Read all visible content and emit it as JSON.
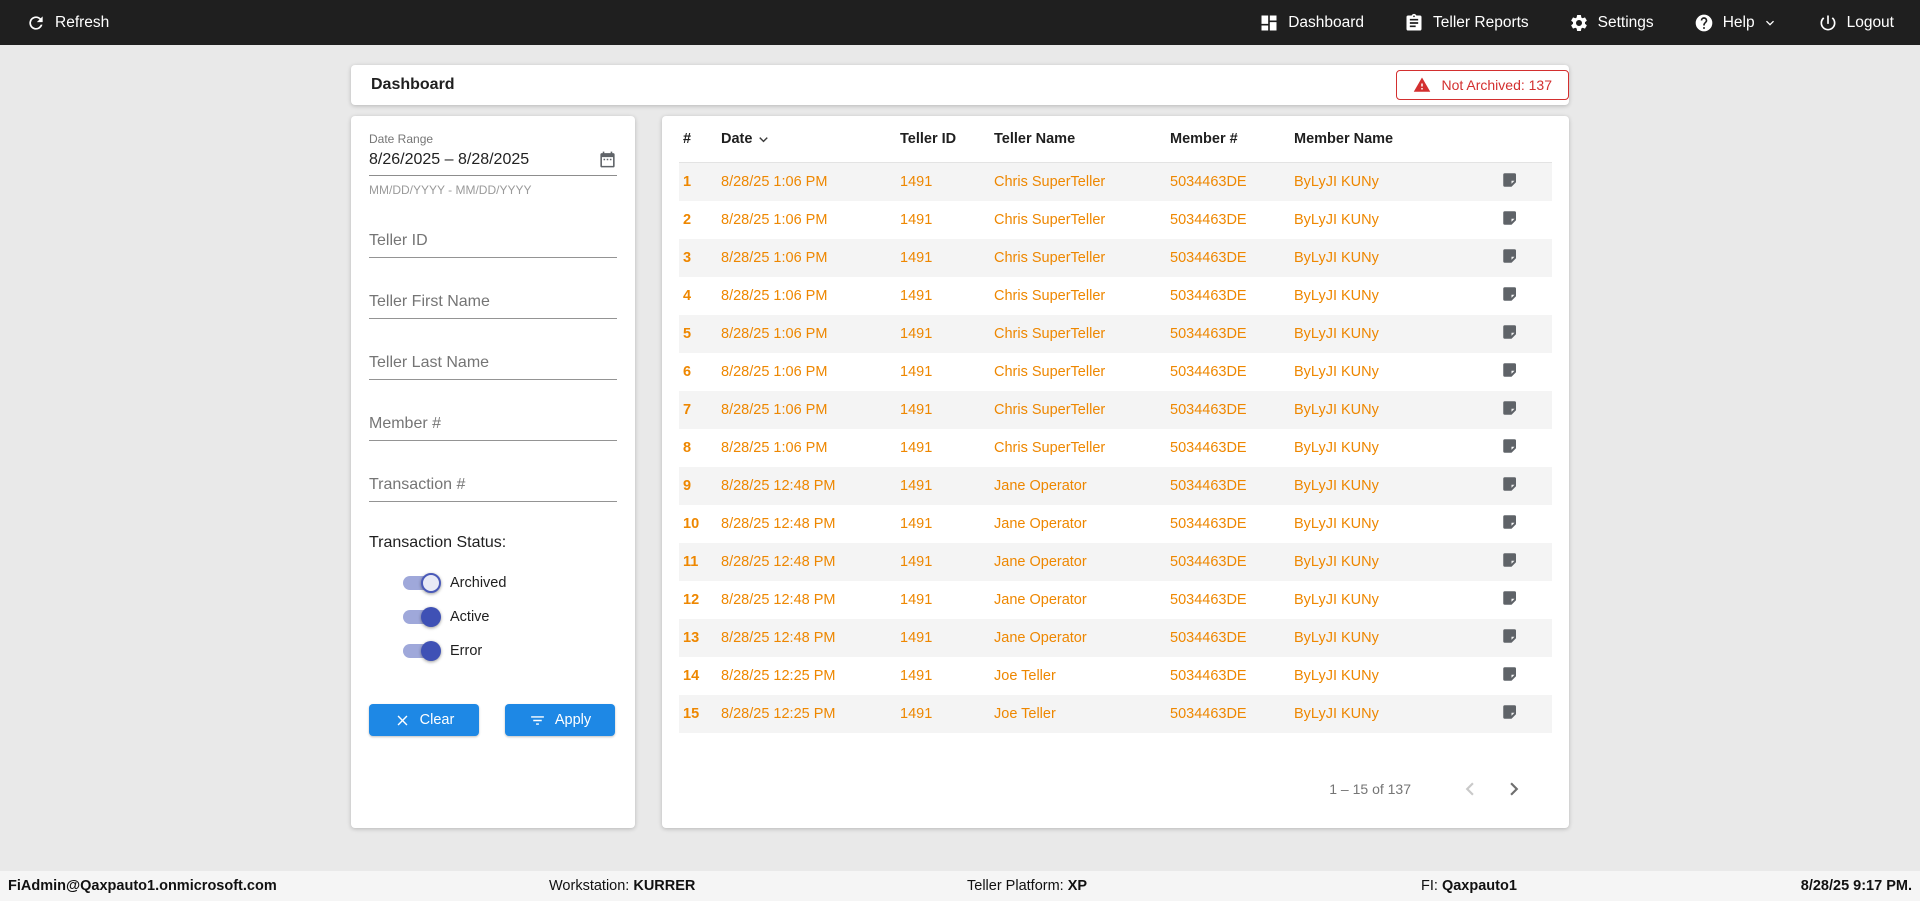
{
  "colors": {
    "topbar": "#1f1f1f",
    "accent_blue": "#1e88e5",
    "row_orange": "#ee8700",
    "alert_red": "#d32f2f",
    "toggle_thumb": "#3f51b5",
    "toggle_track": "#9fa8da"
  },
  "topnav": {
    "refresh": "Refresh",
    "dashboard": "Dashboard",
    "teller_reports": "Teller Reports",
    "settings": "Settings",
    "help": "Help",
    "logout": "Logout"
  },
  "header": {
    "title": "Dashboard",
    "alert_badge": "Not Archived: 137"
  },
  "filters": {
    "date_range_label": "Date Range",
    "date_range_value": "8/26/2025 – 8/28/2025",
    "date_range_hint": "MM/DD/YYYY - MM/DD/YYYY",
    "teller_id_placeholder": "Teller ID",
    "teller_first_name_placeholder": "Teller First Name",
    "teller_last_name_placeholder": "Teller Last Name",
    "member_placeholder": "Member #",
    "transaction_placeholder": "Transaction #",
    "status_label": "Transaction Status:",
    "toggles": [
      {
        "label": "Archived",
        "on": true,
        "hollow": true
      },
      {
        "label": "Active",
        "on": true
      },
      {
        "label": "Error",
        "on": true
      }
    ],
    "clear_label": "Clear",
    "apply_label": "Apply"
  },
  "table": {
    "columns": [
      "#",
      "Date",
      "Teller ID",
      "Teller Name",
      "Member #",
      "Member Name"
    ],
    "rows": [
      {
        "num": "1",
        "date": "8/28/25 1:06 PM",
        "teller_id": "1491",
        "teller_name": "Chris SuperTeller",
        "member": "5034463DE",
        "member_name": "ByLyJI KUNy"
      },
      {
        "num": "2",
        "date": "8/28/25 1:06 PM",
        "teller_id": "1491",
        "teller_name": "Chris SuperTeller",
        "member": "5034463DE",
        "member_name": "ByLyJI KUNy"
      },
      {
        "num": "3",
        "date": "8/28/25 1:06 PM",
        "teller_id": "1491",
        "teller_name": "Chris SuperTeller",
        "member": "5034463DE",
        "member_name": "ByLyJI KUNy"
      },
      {
        "num": "4",
        "date": "8/28/25 1:06 PM",
        "teller_id": "1491",
        "teller_name": "Chris SuperTeller",
        "member": "5034463DE",
        "member_name": "ByLyJI KUNy"
      },
      {
        "num": "5",
        "date": "8/28/25 1:06 PM",
        "teller_id": "1491",
        "teller_name": "Chris SuperTeller",
        "member": "5034463DE",
        "member_name": "ByLyJI KUNy"
      },
      {
        "num": "6",
        "date": "8/28/25 1:06 PM",
        "teller_id": "1491",
        "teller_name": "Chris SuperTeller",
        "member": "5034463DE",
        "member_name": "ByLyJI KUNy"
      },
      {
        "num": "7",
        "date": "8/28/25 1:06 PM",
        "teller_id": "1491",
        "teller_name": "Chris SuperTeller",
        "member": "5034463DE",
        "member_name": "ByLyJI KUNy"
      },
      {
        "num": "8",
        "date": "8/28/25 1:06 PM",
        "teller_id": "1491",
        "teller_name": "Chris SuperTeller",
        "member": "5034463DE",
        "member_name": "ByLyJI KUNy"
      },
      {
        "num": "9",
        "date": "8/28/25 12:48 PM",
        "teller_id": "1491",
        "teller_name": "Jane Operator",
        "member": "5034463DE",
        "member_name": "ByLyJI KUNy"
      },
      {
        "num": "10",
        "date": "8/28/25 12:48 PM",
        "teller_id": "1491",
        "teller_name": "Jane Operator",
        "member": "5034463DE",
        "member_name": "ByLyJI KUNy"
      },
      {
        "num": "11",
        "date": "8/28/25 12:48 PM",
        "teller_id": "1491",
        "teller_name": "Jane Operator",
        "member": "5034463DE",
        "member_name": "ByLyJI KUNy"
      },
      {
        "num": "12",
        "date": "8/28/25 12:48 PM",
        "teller_id": "1491",
        "teller_name": "Jane Operator",
        "member": "5034463DE",
        "member_name": "ByLyJI KUNy"
      },
      {
        "num": "13",
        "date": "8/28/25 12:48 PM",
        "teller_id": "1491",
        "teller_name": "Jane Operator",
        "member": "5034463DE",
        "member_name": "ByLyJI KUNy"
      },
      {
        "num": "14",
        "date": "8/28/25 12:25 PM",
        "teller_id": "1491",
        "teller_name": "Joe Teller",
        "member": "5034463DE",
        "member_name": "ByLyJI KUNy"
      },
      {
        "num": "15",
        "date": "8/28/25 12:25 PM",
        "teller_id": "1491",
        "teller_name": "Joe Teller",
        "member": "5034463DE",
        "member_name": "ByLyJI KUNy"
      }
    ],
    "pagination_range": "1 – 15 of 137"
  },
  "footer": {
    "user": "FiAdmin@Qaxpauto1.onmicrosoft.com",
    "workstation_label": "Workstation:",
    "workstation_value": "KURRER",
    "platform_label": "Teller Platform:",
    "platform_value": "XP",
    "fi_label": "FI:",
    "fi_value": "Qaxpauto1",
    "datetime": "8/28/25 9:17 PM."
  }
}
